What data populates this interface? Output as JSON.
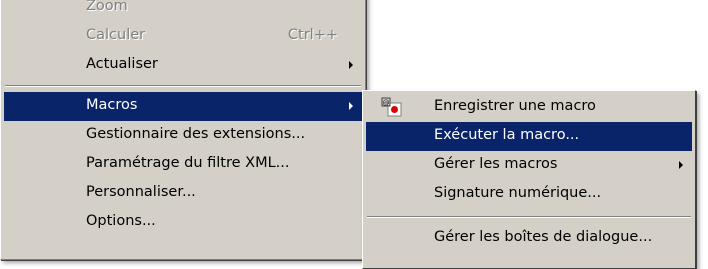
{
  "tools_menu": {
    "items": [
      {
        "label": "Zoom",
        "disabled": true
      },
      {
        "label": "Calculer",
        "shortcut": "Ctrl++",
        "disabled": true
      },
      {
        "label": "Actualiser",
        "submenu": true
      },
      {
        "label": "Macros",
        "submenu": true,
        "highlighted": true
      },
      {
        "label": "Gestionnaire des extensions..."
      },
      {
        "label": "Paramétrage du filtre XML..."
      },
      {
        "label": "Personnaliser..."
      },
      {
        "label": "Options..."
      }
    ]
  },
  "macros_submenu": {
    "items": [
      {
        "label": "Enregistrer une macro",
        "icon": "record-macro-icon"
      },
      {
        "label": "Exécuter la macro...",
        "highlighted": true
      },
      {
        "label": "Gérer les macros",
        "submenu": true
      },
      {
        "label": "Signature numérique..."
      },
      {
        "label": "Gérer les boîtes de dialogue..."
      }
    ]
  },
  "colors": {
    "menu_background": "#d4d0c8",
    "highlight": "#0a246a",
    "highlight_text": "#ffffff",
    "disabled_text": "#808080"
  }
}
